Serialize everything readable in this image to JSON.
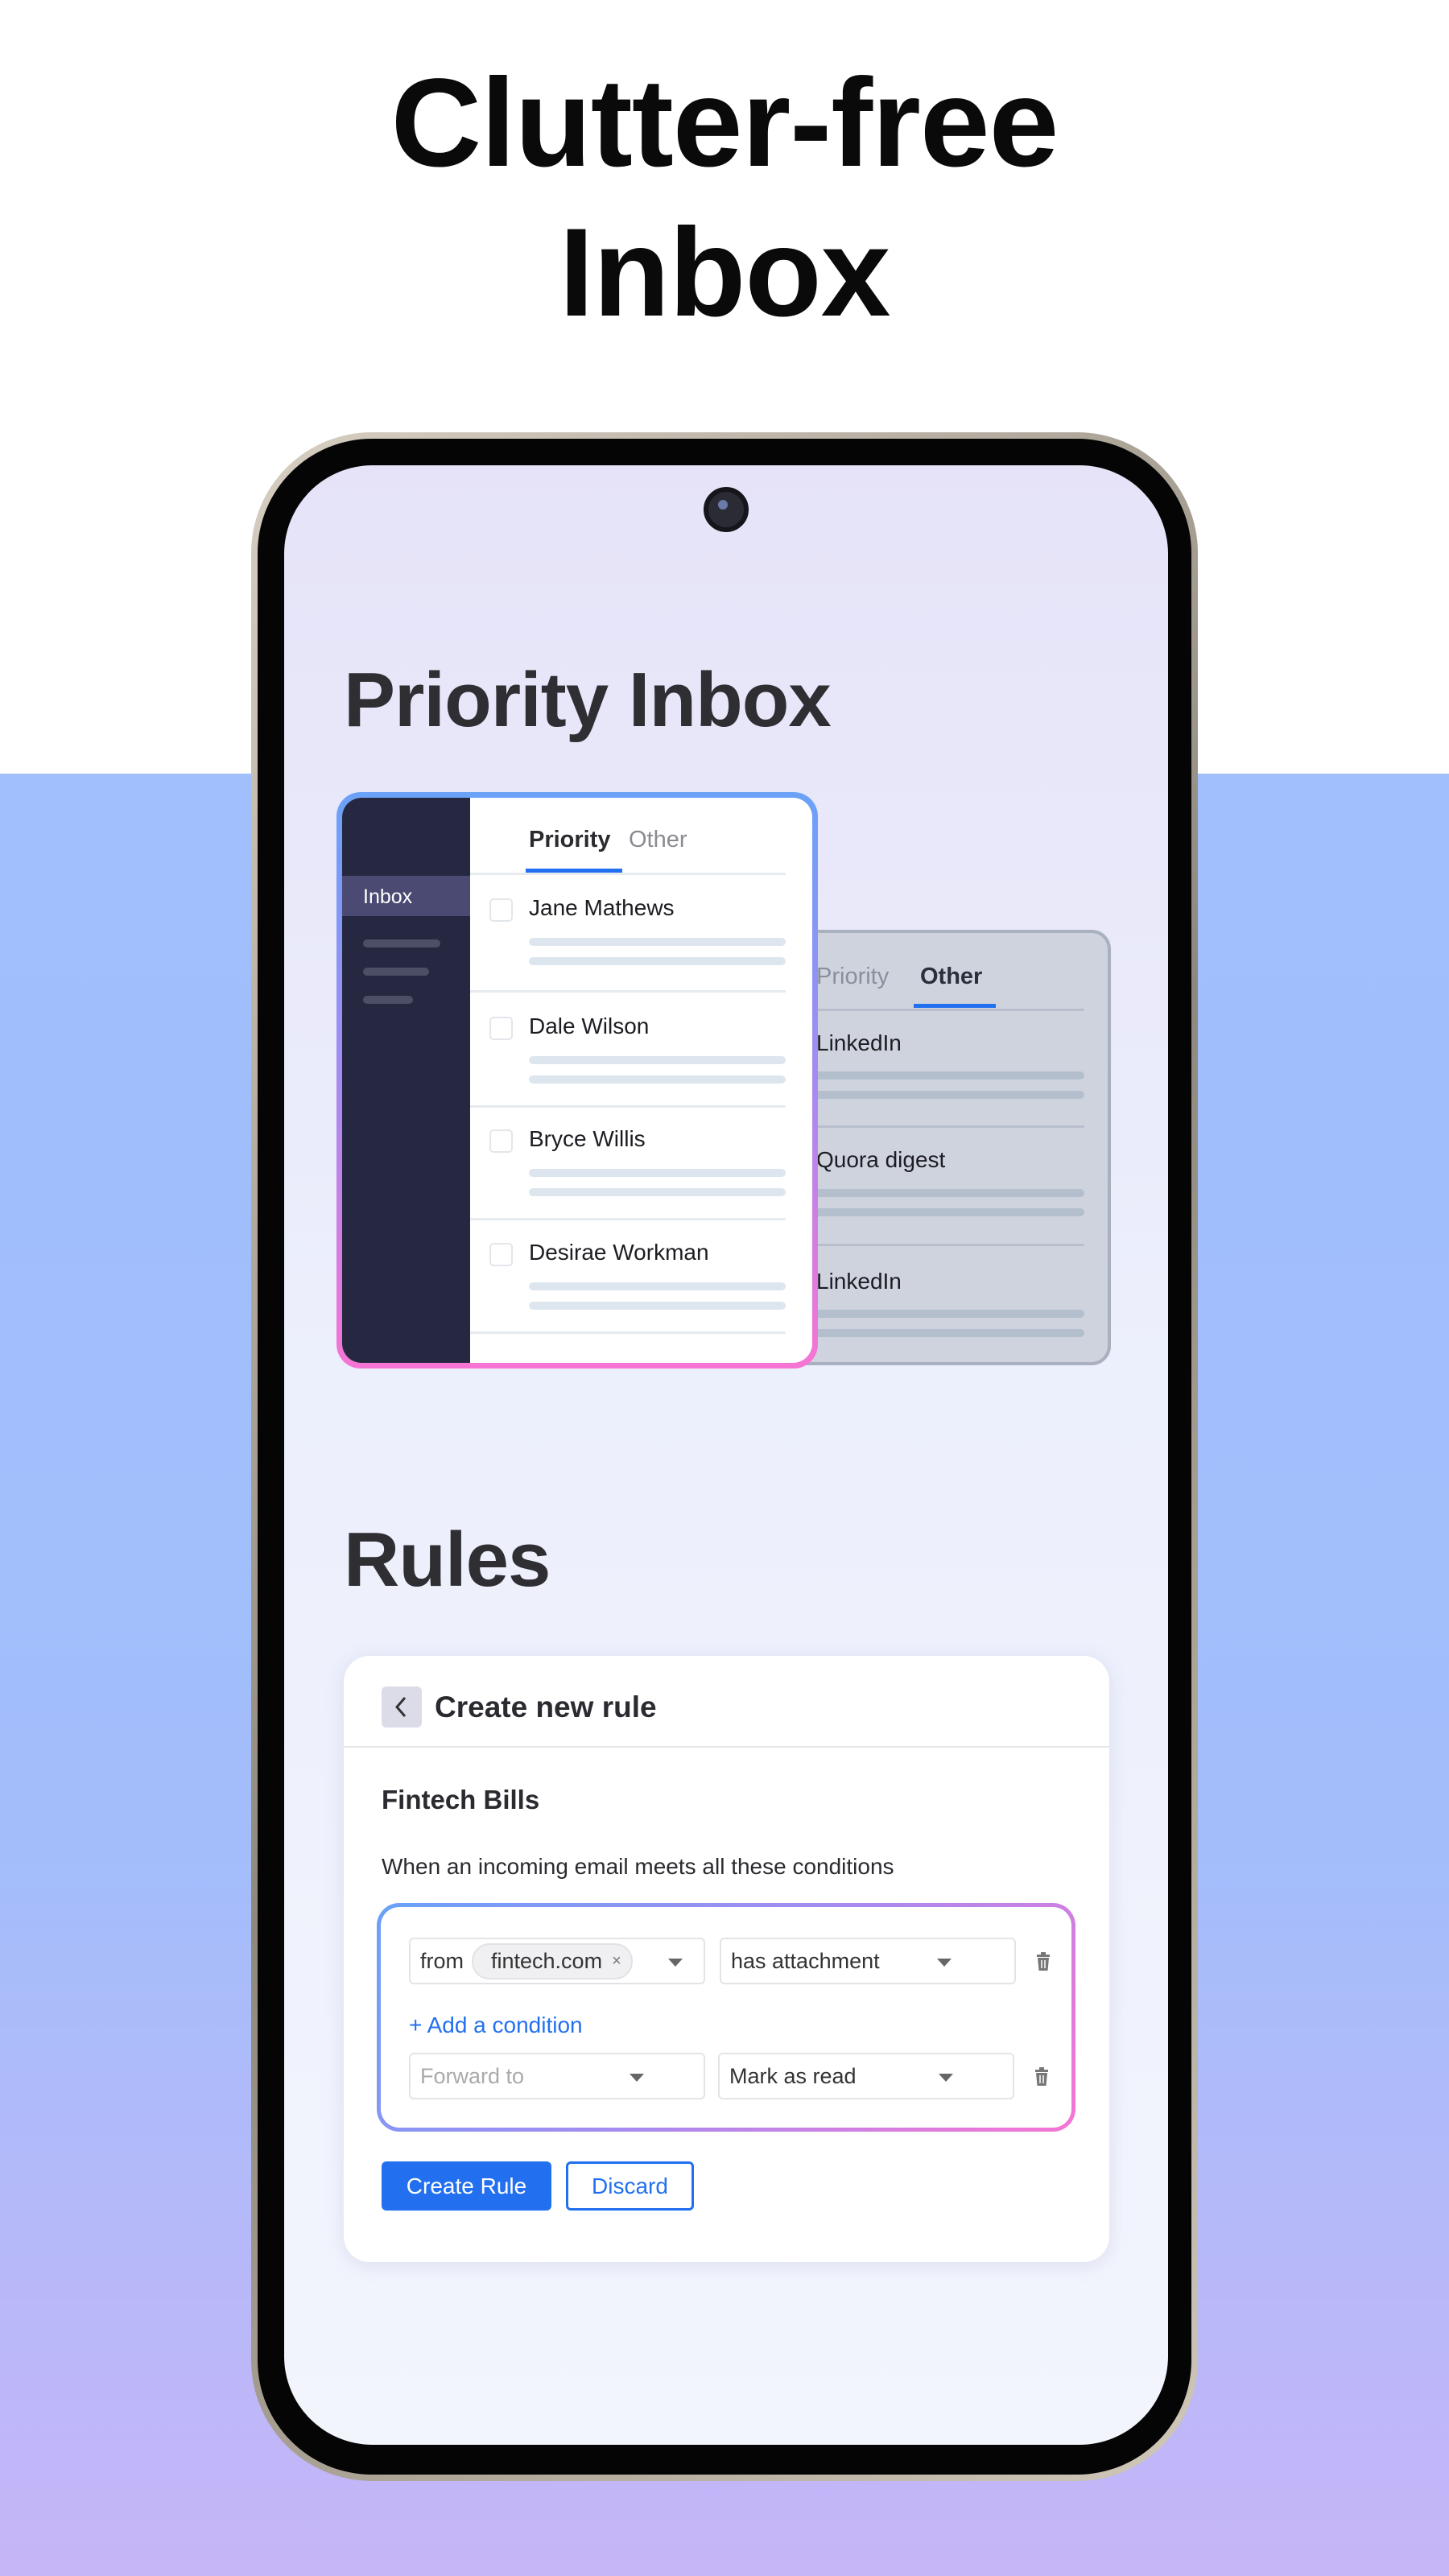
{
  "headline": {
    "line1": "Clutter-free",
    "line2": "Inbox"
  },
  "sections": {
    "priority_inbox": "Priority Inbox",
    "rules": "Rules"
  },
  "front_card": {
    "sidebar": {
      "active_item": "Inbox"
    },
    "tabs": [
      {
        "label": "Priority",
        "active": true
      },
      {
        "label": "Other",
        "active": false
      }
    ],
    "rows": [
      "Jane Mathews",
      "Dale Wilson",
      "Bryce Willis",
      "Desirae Workman"
    ]
  },
  "back_card": {
    "tabs": [
      {
        "label": "Priority",
        "active": false
      },
      {
        "label": "Other",
        "active": true
      }
    ],
    "rows": [
      "LinkedIn",
      "Quora digest",
      "LinkedIn"
    ]
  },
  "rule": {
    "title": "Create new rule",
    "name": "Fintech Bills",
    "description": "When an incoming email meets all these conditions",
    "condition": {
      "field_label": "from",
      "chip": "fintech.com",
      "chip_remove": "×",
      "operator": "has attachment"
    },
    "add_condition": "+ Add a condition",
    "action": {
      "target_placeholder": "Forward to",
      "action": "Mark as read"
    },
    "create_button": "Create Rule",
    "discard_button": "Discard"
  },
  "colors": {
    "accent": "#2270f0",
    "sidebar": "#252840",
    "background_top": "#a0bffc",
    "background_bottom": "#c6b5f7"
  }
}
